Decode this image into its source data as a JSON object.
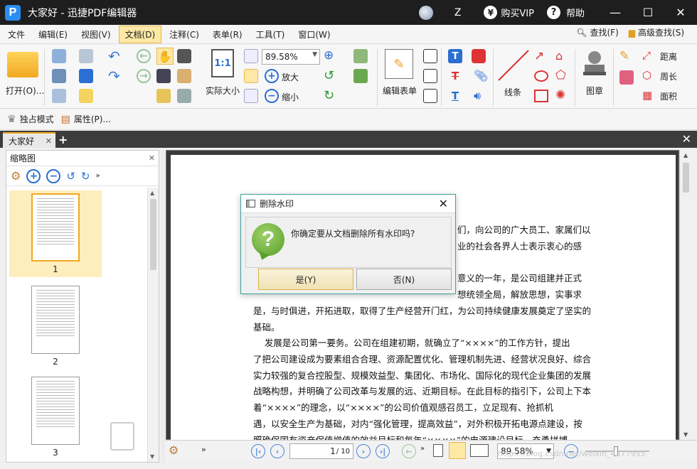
{
  "window": {
    "tab_title": "大家好",
    "app_name": "迅捷PDF编辑器",
    "user": "Z",
    "buy_vip": "购买VIP",
    "help": "帮助",
    "min": "—",
    "max": "☐",
    "close": "✕"
  },
  "menu": {
    "items": [
      "文件",
      "编辑(E)",
      "视图(V)",
      "文档(D)",
      "注释(C)",
      "表单(R)",
      "工具(T)",
      "窗口(W)"
    ],
    "find": "查找(F)",
    "advanced_find": "高级查找(S)"
  },
  "ribbon": {
    "open": "打开(O)...",
    "actual_size": "实际大小",
    "zoom_value": "89.58%",
    "zoom_in": "放大",
    "zoom_out": "缩小",
    "edit_form": "编辑表单",
    "line": "线条",
    "stamp": "图章",
    "distance": "距离",
    "perimeter": "周长",
    "area": "面积"
  },
  "subbar": {
    "exclusive_mode": "独占模式",
    "properties": "属性(P)..."
  },
  "thumbnail_panel": {
    "title": "缩略图",
    "pages": [
      "1",
      "2",
      "3"
    ]
  },
  "document": {
    "lines": [
      "们，向公司的广大员工、家属们以",
      "业的社会各界人士表示衷心的感",
      "意义的一年，是公司组建并正式",
      "想统领全局，解放思想，实事求",
      "是，与时俱进，开拓进取，取得了生产经营开门红，为公司持续健康发展奠定了坚实的",
      "基础。",
      "    发展是公司第一要务。公司在组建初期，就确立了“××××”的工作方针，提出",
      "了把公司建设成为要素组合合理、资源配置优化、管理机制先进、经营状况良好、综合",
      "实力较强的复合控股型、规模效益型、集团化、市场化、国际化的现代企业集团的发展",
      "战略构想，并明确了公司改革与发展的远、近期目标。在此目标的指引下，公司上下本",
      "着“××××”的理念，以“××××”的公司价值观感召员工，立足现有、抢抓机",
      "遇，以安全生产为基础，对内“强化管理，提高效益”，对外积极开拓电源点建设，按",
      "照确保国有资产保值增值的效益目标和每年“××××”的电源建设目标，奋勇拼搏，"
    ]
  },
  "status_bar": {
    "current_page": "1",
    "total_pages": "/ 10",
    "zoom": "89.58%",
    "watermark_text": "https://blog.csdn.net/weixin_4377955"
  },
  "dialog": {
    "title": "删除水印",
    "message": "你确定要从文档删除所有水印吗?",
    "yes": "是(Y)",
    "no": "否(N)"
  }
}
